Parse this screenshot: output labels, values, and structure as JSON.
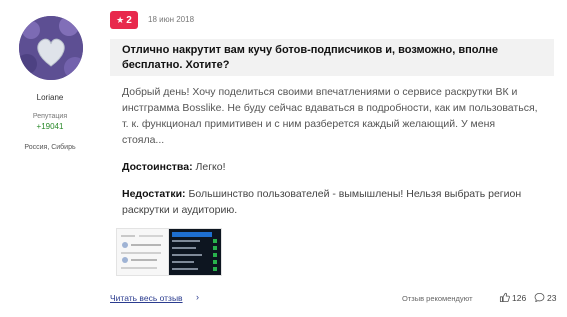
{
  "user": {
    "name": "Loriane",
    "reputation_label": "Репутация",
    "reputation_value": "+19041",
    "location": "Россия, Сибирь"
  },
  "review": {
    "rating": "2",
    "date": "18 июн 2018",
    "title_line1": "Отлично накрутит вам кучу ботов-подписчиков и, возможно, вполне",
    "title_line2": "бесплатно. Хотите?",
    "text": "Добрый день! Хочу поделиться своими впечатлениями о сервисе раскрутки ВК и инстграмма Bosslike. Не буду сейчас вдаваться в подробности, как им пользоваться, т. к. функционал примитивен и с ним разберется каждый желающий. У меня стояла...",
    "pros_label": "Достоинства:",
    "pros_value": "Легко!",
    "cons_label": "Недостатки:",
    "cons_value": "Большинство пользователей - вымышлены! Нельзя выбрать регион раскрутки и аудиторию."
  },
  "footer": {
    "read_all": "Читать весь отзыв",
    "recommend": "Отзыв рекомендуют",
    "likes": "126",
    "comments": "23"
  },
  "colors": {
    "badge": "#e8294d",
    "link": "#2b3c8f",
    "reputation": "#2a8a2a"
  }
}
